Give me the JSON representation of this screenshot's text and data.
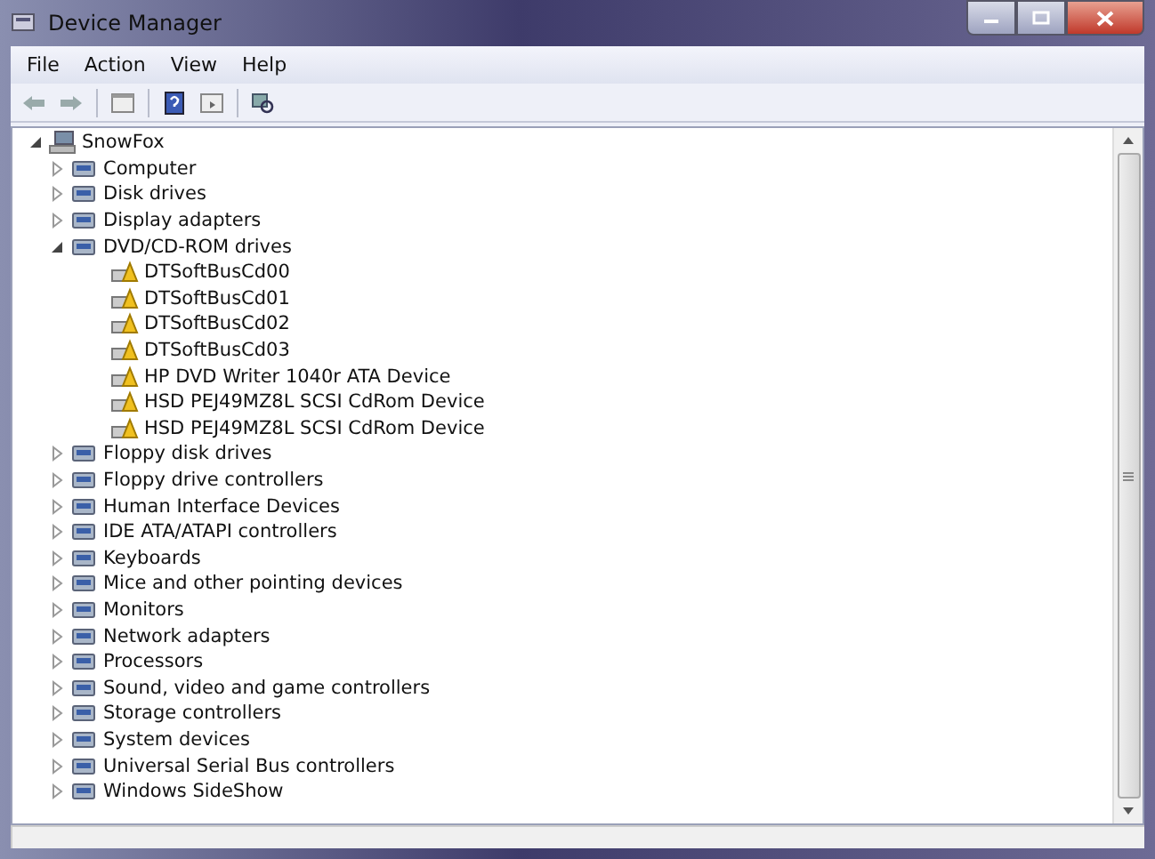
{
  "window": {
    "title": "Device Manager"
  },
  "menu": [
    "File",
    "Action",
    "View",
    "Help"
  ],
  "tree": [
    {
      "label": "SnowFox",
      "expanded": true,
      "children": [
        {
          "label": "Computer",
          "expanded": false
        },
        {
          "label": "Disk drives",
          "expanded": false
        },
        {
          "label": "Display adapters",
          "expanded": false
        },
        {
          "label": "DVD/CD-ROM drives",
          "expanded": true,
          "children": [
            {
              "label": "DTSoftBusCd00"
            },
            {
              "label": "DTSoftBusCd01"
            },
            {
              "label": "DTSoftBusCd02"
            },
            {
              "label": "DTSoftBusCd03"
            },
            {
              "label": "HP DVD Writer 1040r ATA Device"
            },
            {
              "label": "HSD PEJ49MZ8L SCSI CdRom Device"
            },
            {
              "label": "HSD PEJ49MZ8L SCSI CdRom Device"
            }
          ]
        },
        {
          "label": "Floppy disk drives",
          "expanded": false
        },
        {
          "label": "Floppy drive controllers",
          "expanded": false
        },
        {
          "label": "Human Interface Devices",
          "expanded": false
        },
        {
          "label": "IDE ATA/ATAPI controllers",
          "expanded": false
        },
        {
          "label": "Keyboards",
          "expanded": false
        },
        {
          "label": "Mice and other pointing devices",
          "expanded": false
        },
        {
          "label": "Monitors",
          "expanded": false
        },
        {
          "label": "Network adapters",
          "expanded": false
        },
        {
          "label": "Processors",
          "expanded": false
        },
        {
          "label": "Sound, video and game controllers",
          "expanded": false
        },
        {
          "label": "Storage controllers",
          "expanded": false
        },
        {
          "label": "System devices",
          "expanded": false
        },
        {
          "label": "Universal Serial Bus controllers",
          "expanded": false
        },
        {
          "label": "Windows SideShow",
          "expanded": false
        }
      ]
    }
  ]
}
